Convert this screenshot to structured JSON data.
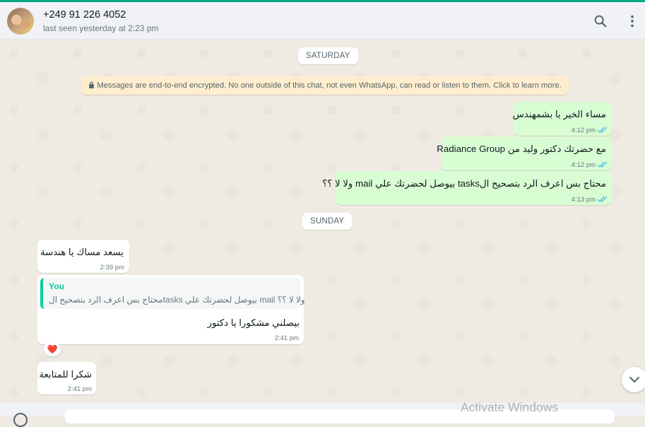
{
  "header": {
    "contact_name": "+249 91 226 4052",
    "contact_status": "last seen yesterday at 2:23 pm",
    "icons": [
      "search-icon",
      "menu-dots-icon"
    ]
  },
  "chat": {
    "day_saturday": "SATURDAY",
    "encryption_notice": "Messages are end-to-end encrypted. No one outside of this chat, not even WhatsApp, can read or listen to them. Click to learn more.",
    "day_sunday": "SUNDAY",
    "messages": [
      {
        "direction": "outgoing",
        "text": "مساء الخير يا بشمهندس",
        "time": "4:12 pm",
        "status": "read"
      },
      {
        "direction": "outgoing",
        "text": "مع حضرتك دكتور وليد من Radiance Group",
        "time": "4:12 pm",
        "status": "read"
      },
      {
        "direction": "outgoing",
        "text": "محتاج بس اعرف الرد بتصحيح الtasks بيوصل لحضرتك علي mail ولا لا ؟؟",
        "time": "4:13 pm",
        "status": "read"
      },
      {
        "direction": "incoming",
        "text": "يسعد مساك يا هندسة",
        "time": "2:39 pm"
      },
      {
        "direction": "incoming",
        "text": "بيصلني مشكورا يا دكتور",
        "time": "2:41 pm",
        "quote": {
          "author": "You",
          "text": "محتاج بس اعرف الرد بتصحيح الtasks بيوصل لحضرتك علي mail ولا لا ؟؟"
        },
        "reaction": "❤️"
      },
      {
        "direction": "incoming",
        "text": "شكرا للمتابعة",
        "time": "2:41 pm"
      }
    ]
  },
  "overlay": {
    "watermark": "Activate Windows"
  },
  "colors": {
    "accent": "#00a884",
    "outgoing_bubble": "#d9fdd3",
    "incoming_bubble": "#ffffff",
    "read_ticks": "#53bdeb",
    "quote_author": "#06cf9c"
  }
}
